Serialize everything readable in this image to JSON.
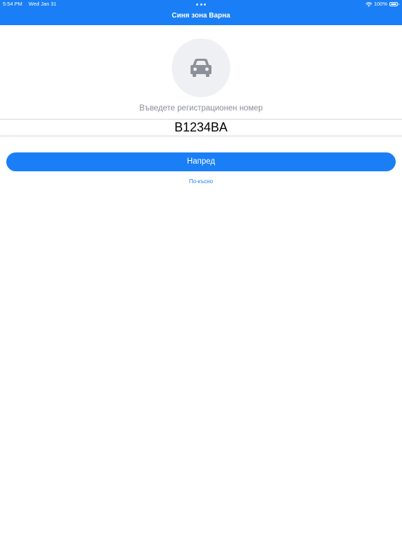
{
  "status_bar": {
    "time": "5:54 PM",
    "date": "Wed Jan 31",
    "battery_text": "100%",
    "wifi_icon": "wifi-icon",
    "battery_icon": "battery-icon",
    "multitask_icon": "multitasking-dots-icon"
  },
  "nav": {
    "title": "Синя зона Варна"
  },
  "form": {
    "avatar_icon": "car-icon",
    "prompt": "Въведете регистрационен номер",
    "plate_value": "B1234BA",
    "next_label": "Напред",
    "later_label": "По-късно"
  },
  "colors": {
    "accent": "#1a7ff6",
    "avatar_bg": "#eff0f4",
    "car_icon": "#8c9199",
    "prompt_text": "#8a8f96"
  }
}
